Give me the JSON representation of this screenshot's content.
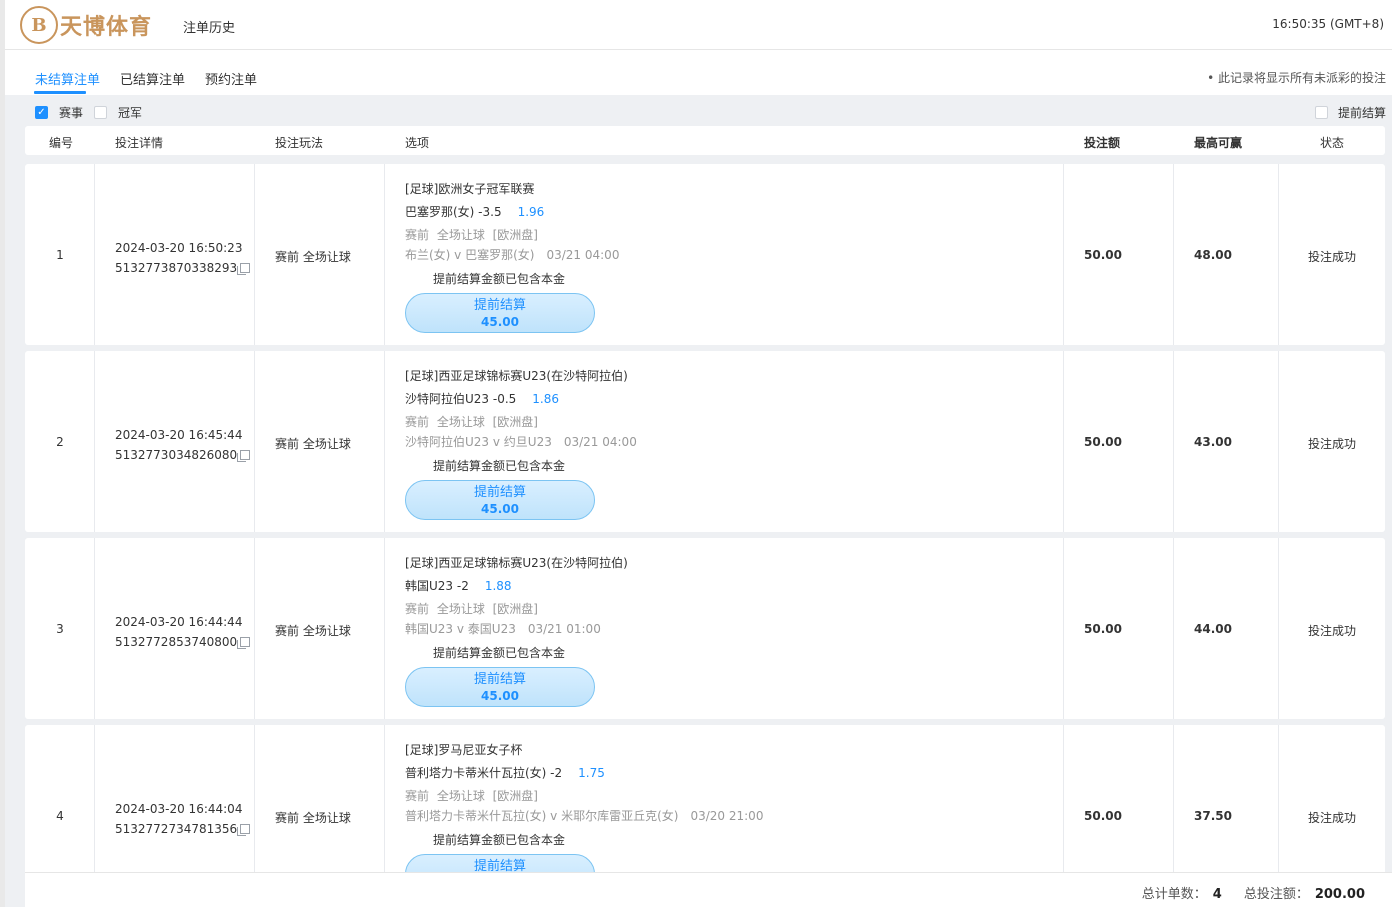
{
  "header": {
    "logo_mark": "B",
    "logo_text": "天博体育",
    "title": "注单历史",
    "clock": "16:50:35 (GMT+8)"
  },
  "tabs": [
    {
      "label": "未结算注单",
      "active": true
    },
    {
      "label": "已结算注单",
      "active": false
    },
    {
      "label": "预约注单",
      "active": false
    }
  ],
  "tab_note": "• 此记录将显示所有未派彩的投注",
  "filters": {
    "event": {
      "label": "赛事",
      "checked": true
    },
    "champion": {
      "label": "冠军",
      "checked": false
    },
    "cashout": {
      "label": "提前结算",
      "checked": false
    }
  },
  "columns": [
    "编号",
    "投注详情",
    "投注玩法",
    "选项",
    "投注额",
    "最高可赢",
    "状态"
  ],
  "rows": [
    {
      "no": "1",
      "time": "2024-03-20 16:50:23",
      "bet_id": "5132773870338293",
      "play": "赛前 全场让球",
      "league": "[足球]欧洲女子冠军联赛",
      "pick": "巴塞罗那(女) -3.5",
      "odds": "1.96",
      "meta": "赛前 全场让球 [欧洲盘]",
      "match": "布兰(女) v 巴塞罗那(女)",
      "match_time": "03/21 04:00",
      "note": "提前结算金额已包含本金",
      "cash_label": "提前结算",
      "cash_value": "45.00",
      "stake": "50.00",
      "max_win": "48.00",
      "status": "投注成功"
    },
    {
      "no": "2",
      "time": "2024-03-20 16:45:44",
      "bet_id": "5132773034826080",
      "play": "赛前 全场让球",
      "league": "[足球]西亚足球锦标赛U23(在沙特阿拉伯)",
      "pick": "沙特阿拉伯U23 -0.5",
      "odds": "1.86",
      "meta": "赛前 全场让球 [欧洲盘]",
      "match": "沙特阿拉伯U23 v 约旦U23",
      "match_time": "03/21 04:00",
      "note": "提前结算金额已包含本金",
      "cash_label": "提前结算",
      "cash_value": "45.00",
      "stake": "50.00",
      "max_win": "43.00",
      "status": "投注成功"
    },
    {
      "no": "3",
      "time": "2024-03-20 16:44:44",
      "bet_id": "5132772853740800",
      "play": "赛前 全场让球",
      "league": "[足球]西亚足球锦标赛U23(在沙特阿拉伯)",
      "pick": "韩国U23 -2",
      "odds": "1.88",
      "meta": "赛前 全场让球 [欧洲盘]",
      "match": "韩国U23 v 泰国U23",
      "match_time": "03/21 01:00",
      "note": "提前结算金额已包含本金",
      "cash_label": "提前结算",
      "cash_value": "45.00",
      "stake": "50.00",
      "max_win": "44.00",
      "status": "投注成功"
    },
    {
      "no": "4",
      "time": "2024-03-20 16:44:04",
      "bet_id": "5132772734781356",
      "play": "赛前 全场让球",
      "league": "[足球]罗马尼亚女子杯",
      "pick": "普利塔力卡蒂米什瓦拉(女) -2",
      "odds": "1.75",
      "meta": "赛前 全场让球 [欧洲盘]",
      "match": "普利塔力卡蒂米什瓦拉(女) v 米耶尔库雷亚丘克(女)",
      "match_time": "03/20 21:00",
      "note": "提前结算金额已包含本金",
      "cash_label": "提前结算",
      "cash_value": "",
      "stake": "50.00",
      "max_win": "37.50",
      "status": "投注成功"
    }
  ],
  "footer": {
    "count_label": "总计单数：",
    "count_value": "4",
    "total_label": "总投注额：",
    "total_value": "200.00"
  }
}
